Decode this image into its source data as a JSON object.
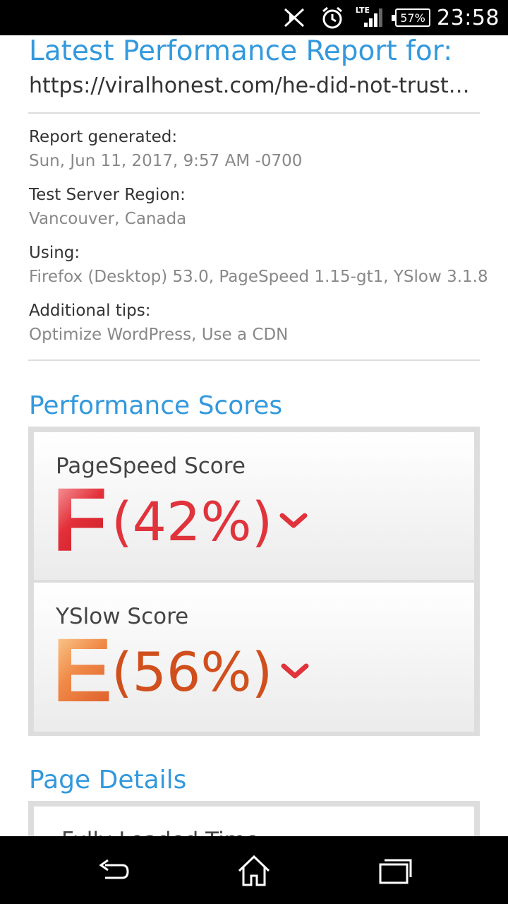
{
  "status_bar": {
    "network": "LTE",
    "battery": "57%",
    "time": "23:58",
    "icons": [
      "mute-icon",
      "alarm-icon",
      "signal-icon",
      "battery-icon"
    ]
  },
  "report": {
    "title": "Latest Performance Report for:",
    "url": "https://viralhonest.com/he-did-not-trust-his-wife-so-he-installed-hidden-camera",
    "url_display": "https://viralhonest.com/he-did-not-trust-hi…",
    "info": [
      {
        "label": "Report generated:",
        "value": "Sun, Jun 11, 2017, 9:57 AM -0700"
      },
      {
        "label": "Test Server Region:",
        "value": "Vancouver, Canada"
      },
      {
        "label": "Using:",
        "value": "Firefox (Desktop) 53.0, PageSpeed 1.15-gt1, YSlow 3.1.8"
      },
      {
        "label": "Additional tips:",
        "value": "Optimize WordPress, Use a CDN"
      }
    ]
  },
  "performance": {
    "title": "Performance Scores",
    "scores": [
      {
        "label": "PageSpeed Score",
        "grade": "F",
        "percent": "(42%)",
        "color": "#e0333c"
      },
      {
        "label": "YSlow Score",
        "grade": "E",
        "percent": "(56%)",
        "color": "#d04f1c"
      }
    ]
  },
  "page_details": {
    "title": "Page Details",
    "first_label": "Fully Loaded Time"
  },
  "nav": {
    "icons": [
      "back-icon",
      "home-icon",
      "recents-icon"
    ]
  }
}
